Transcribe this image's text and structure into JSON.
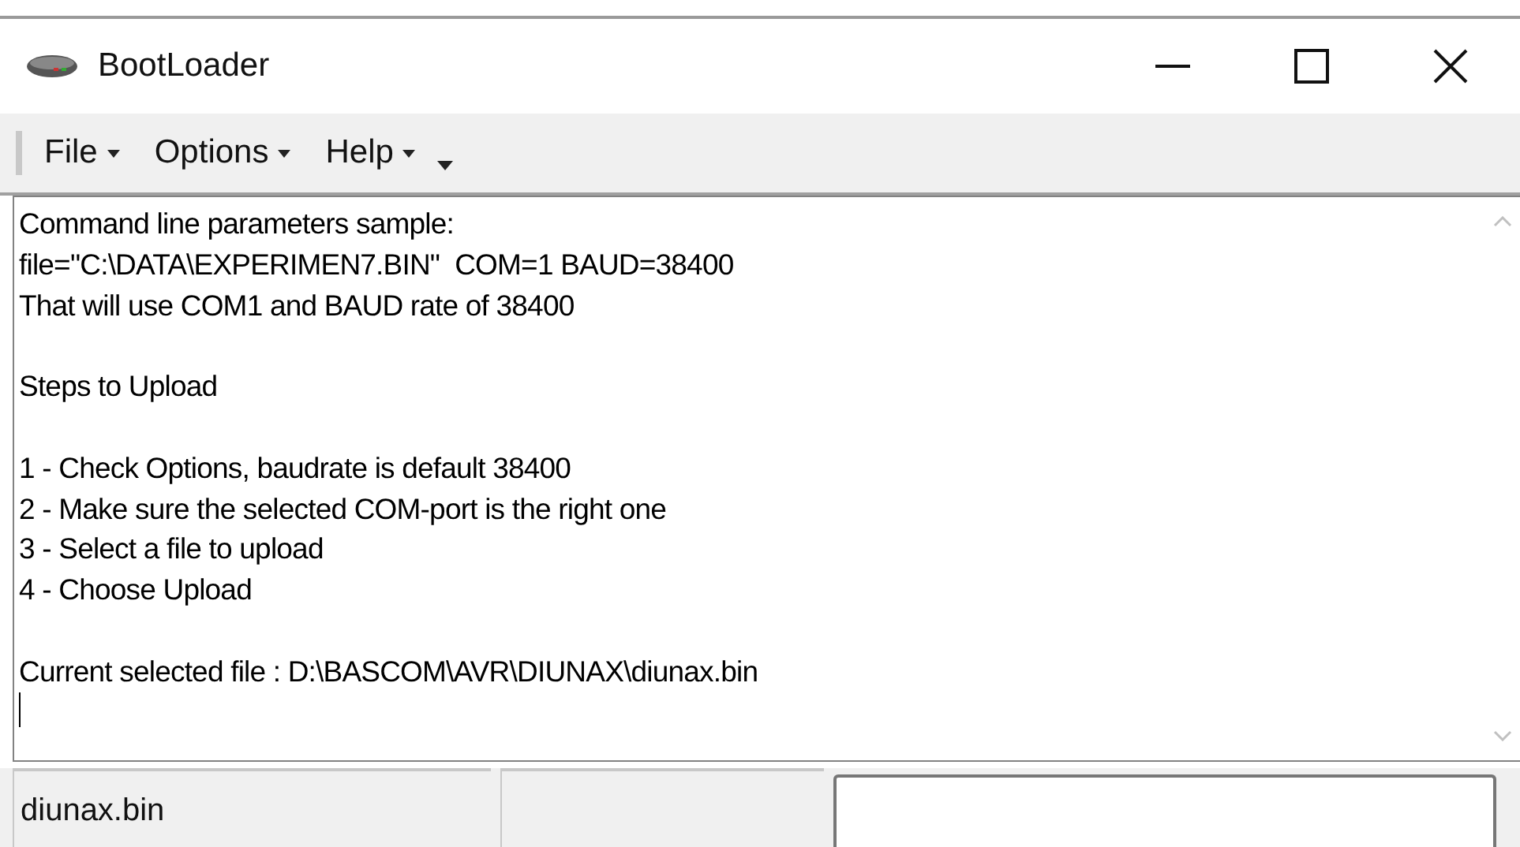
{
  "window": {
    "title": "BootLoader"
  },
  "menu": [
    {
      "label": "File"
    },
    {
      "label": "Options"
    },
    {
      "label": "Help"
    }
  ],
  "memo": {
    "blocks": [
      [
        "Command line parameters sample:",
        "file=\"C:\\DATA\\EXPERIMEN7.BIN\"  COM=1 BAUD=38400",
        "That will use COM1 and BAUD rate of 38400"
      ],
      [
        "Steps to Upload"
      ],
      [
        "1 - Check Options, baudrate is default 38400",
        "2 - Make sure the selected COM-port is the right one",
        "3 - Select a file to upload",
        "4 - Choose Upload"
      ],
      [
        "Current selected file : D:\\BASCOM\\AVR\\DIUNAX\\diunax.bin"
      ]
    ]
  },
  "status_bar": {
    "file": "diunax.bin"
  }
}
